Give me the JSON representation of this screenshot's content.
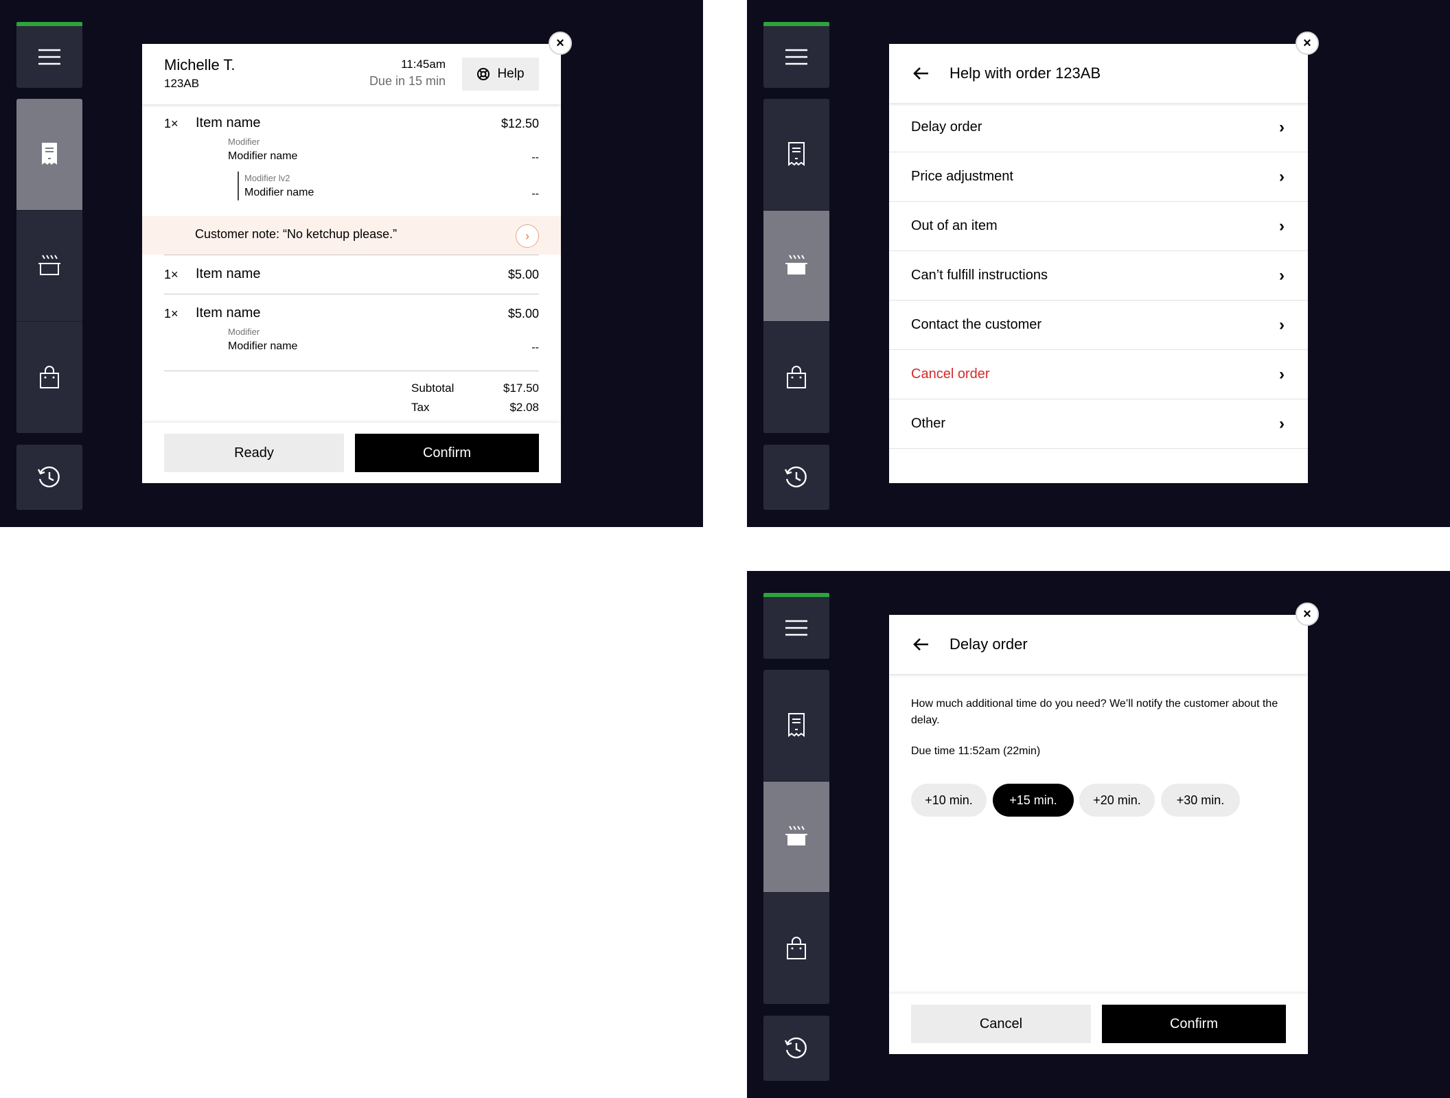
{
  "colors": {
    "background": "#0c0c1c",
    "rail": "#282a3a",
    "active_tab": "#7a7a85",
    "status_bar": "#2ea43c",
    "note_bg": "#fdf1ec",
    "danger": "#d32b2b"
  },
  "nav": {
    "icons": [
      "menu-icon",
      "receipt-icon",
      "cooking-pot-icon",
      "shopping-bag-icon",
      "history-icon"
    ]
  },
  "order_details": {
    "active_tab": "orders",
    "customer_name": "Michelle T.",
    "order_code": "123AB",
    "time": "11:45am",
    "due": "Due in 15 min",
    "help_label": "Help",
    "items": [
      {
        "qty": "1×",
        "name": "Item name",
        "price": "$12.50",
        "modifier_label": "Modifier",
        "modifier_name": "Modifier name",
        "modifier_price": "--",
        "modifier_lv2_label": "Modifier lv2",
        "modifier_lv2_name": "Modifier name",
        "modifier_lv2_price": "--"
      },
      {
        "qty": "1×",
        "name": "Item name",
        "price": "$5.00"
      },
      {
        "qty": "1×",
        "name": "Item name",
        "price": "$5.00",
        "modifier_label": "Modifier",
        "modifier_name": "Modifier name",
        "modifier_price": "--"
      }
    ],
    "customer_note": "Customer note: “No ketchup please.”",
    "subtotal_label": "Subtotal",
    "subtotal": "$17.50",
    "tax_label": "Tax",
    "tax": "$2.08",
    "ready_label": "Ready",
    "confirm_label": "Confirm"
  },
  "help_menu": {
    "active_tab": "cooking",
    "title": "Help with order 123AB",
    "options": [
      "Delay order",
      "Price adjustment",
      "Out of an item",
      "Can’t fulfill instructions",
      "Contact the customer",
      "Cancel order",
      "Other"
    ]
  },
  "delay_order": {
    "active_tab": "cooking",
    "title": "Delay order",
    "question": "How much additional time do you need? We’ll notify the customer about the delay.",
    "due_time": "Due time 11:52am (22min)",
    "options": [
      "+10 min.",
      "+15 min.",
      "+20 min.",
      "+30 min."
    ],
    "selected_option": "+15 min.",
    "cancel_label": "Cancel",
    "confirm_label": "Confirm"
  }
}
